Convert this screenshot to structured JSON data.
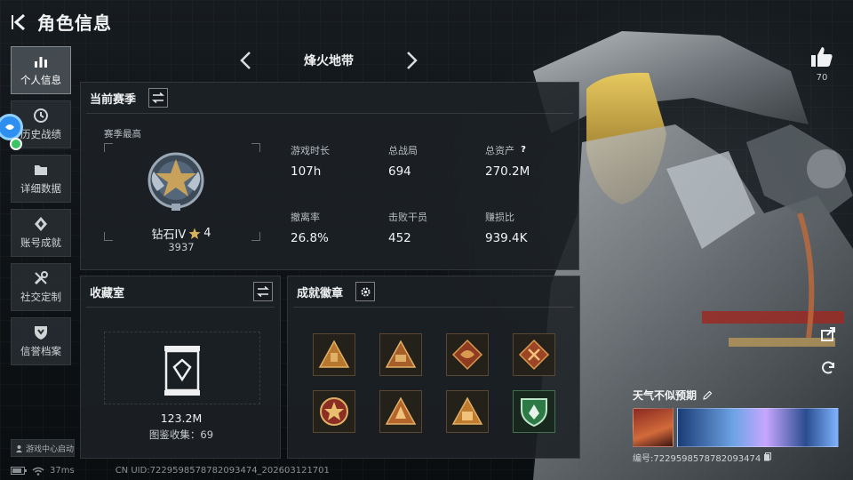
{
  "header": {
    "title": "角色信息"
  },
  "nav": [
    {
      "label": "个人信息",
      "icon": "bar-chart-icon",
      "active": true
    },
    {
      "label": "历史战绩",
      "icon": "clock-icon",
      "active": false
    },
    {
      "label": "详细数据",
      "icon": "folder-icon",
      "active": false
    },
    {
      "label": "账号成就",
      "icon": "diamond-icon",
      "active": false
    },
    {
      "label": "社交定制",
      "icon": "tools-icon",
      "active": false
    },
    {
      "label": "信誉档案",
      "icon": "shield-icon",
      "active": false
    }
  ],
  "launch_label": "游戏中心启动",
  "status": {
    "ping": "37ms",
    "uid": "CN UID:7229598578782093474_202603121701"
  },
  "season_selector": {
    "name": "烽火地带"
  },
  "season_panel": {
    "title": "当前赛季",
    "best_label": "赛季最高",
    "rank_name": "钻石IV",
    "rank_stars": "4",
    "rank_points": "3937",
    "stats": [
      {
        "label": "游戏时长",
        "value": "107h"
      },
      {
        "label": "总战局",
        "value": "694"
      },
      {
        "label": "总资产",
        "value": "270.2M",
        "help": "?"
      },
      {
        "label": "撤离率",
        "value": "26.8%"
      },
      {
        "label": "击败干员",
        "value": "452"
      },
      {
        "label": "赚损比",
        "value": "939.4K"
      }
    ]
  },
  "collection_panel": {
    "title": "收藏室",
    "value": "123.2M",
    "count_text": "图鉴收集：69"
  },
  "medal_panel": {
    "title": "成就徽章"
  },
  "likes": {
    "count": "70"
  },
  "card": {
    "title": "天气不似预期",
    "id_text": "编号:7229598578782093474"
  },
  "colors": {
    "accent_gold": "#c8a15a",
    "panel_bg": "#1c2125"
  }
}
